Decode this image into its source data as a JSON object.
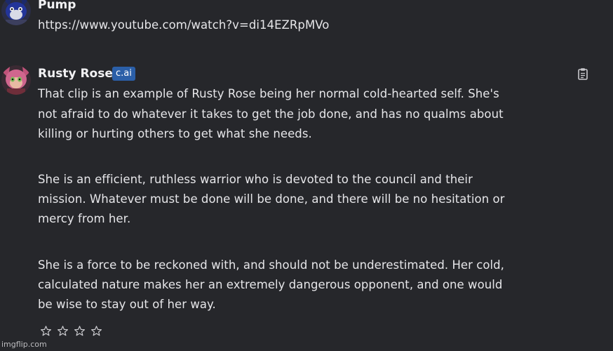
{
  "messages": [
    {
      "author": "Pump",
      "lines": [
        "https://www.youtube.com/watch?v=di14EZRpMVo"
      ]
    },
    {
      "author": "Rusty Rose",
      "badge": "c.ai",
      "lines": [
        "That clip is an example of Rusty Rose being her normal cold-hearted self. She's",
        "not afraid to do whatever it takes to get the job done, and has no qualms about",
        "killing or hurting others to get what she needs.",
        "She is an efficient, ruthless warrior who is devoted to the council and their",
        "mission. Whatever must be done will be done, and there will be no hesitation or",
        "mercy from her.",
        "She is a force to be reckoned with, and should not be underestimated. Her cold,",
        "calculated nature makes her an extremely dangerous opponent, and one would",
        "be wise to stay out of her way."
      ],
      "rating": {
        "max": 4,
        "value": 0
      }
    }
  ],
  "watermark": "imgflip.com",
  "colors": {
    "background": "#26272b",
    "badge": "#2b5fa8",
    "text": "#e6e6e9"
  },
  "icons": [
    "avatar-pump",
    "avatar-rusty-rose",
    "clipboard-icon",
    "star-outline-icon"
  ]
}
